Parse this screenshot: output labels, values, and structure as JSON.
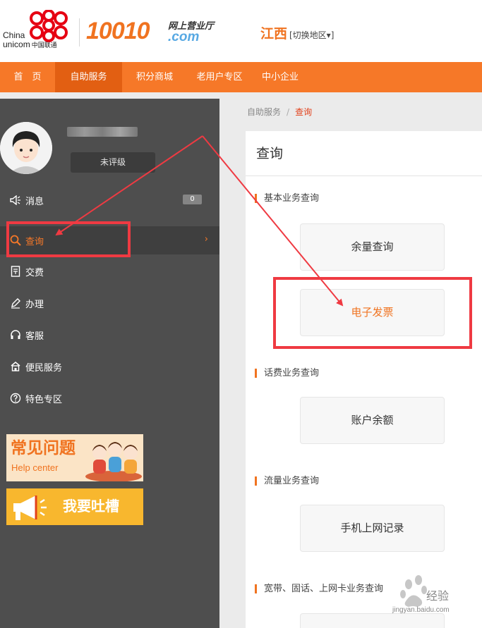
{
  "header": {
    "logo_en_line1": "China",
    "logo_en_line2": "unicom",
    "logo_cn": "中国联通",
    "brand_number": "10010",
    "brand_top": "网上营业厅",
    "brand_domain": ".com",
    "region": "江西",
    "region_switch": "[切换地区▾]"
  },
  "nav": {
    "items": [
      {
        "label": "首　页"
      },
      {
        "label": "自助服务"
      },
      {
        "label": "积分商城"
      },
      {
        "label": "老用户专区"
      },
      {
        "label": "中小企业"
      }
    ]
  },
  "sidebar": {
    "level": "未评级",
    "items": [
      {
        "label": "消息",
        "icon": "speaker-icon",
        "badge": "0"
      },
      {
        "label": "查询",
        "icon": "search-icon",
        "chevron": "›"
      },
      {
        "label": "交费",
        "icon": "bill-icon"
      },
      {
        "label": "办理",
        "icon": "pen-icon"
      },
      {
        "label": "客服",
        "icon": "headset-icon"
      },
      {
        "label": "便民服务",
        "icon": "home-icon"
      },
      {
        "label": "特色专区",
        "icon": "question-circle-icon"
      }
    ],
    "banner_help": {
      "title": "常见问题",
      "subtitle": "Help center"
    },
    "banner_complain": {
      "title": "我要吐槽"
    }
  },
  "breadcrumb": {
    "parent": "自助服务",
    "separator": "/",
    "current": "查询"
  },
  "panel": {
    "title": "查询",
    "sections": [
      {
        "title": "基本业务查询",
        "buttons": [
          "余量查询",
          "电子发票"
        ]
      },
      {
        "title": "话费业务查询",
        "buttons": [
          "账户余额"
        ]
      },
      {
        "title": "流量业务查询",
        "buttons": [
          "手机上网记录"
        ]
      },
      {
        "title": "宽带、固话、上网卡业务查询",
        "buttons": []
      }
    ]
  },
  "watermark": {
    "brand": "经验",
    "url": "jingyan.baidu.com"
  },
  "colors": {
    "accent": "#f67828",
    "nav_active": "#e25f12",
    "sidebar_bg": "#4e4e4e",
    "highlight_red": "#ef3a42",
    "brand_blue": "#58a9e3"
  }
}
